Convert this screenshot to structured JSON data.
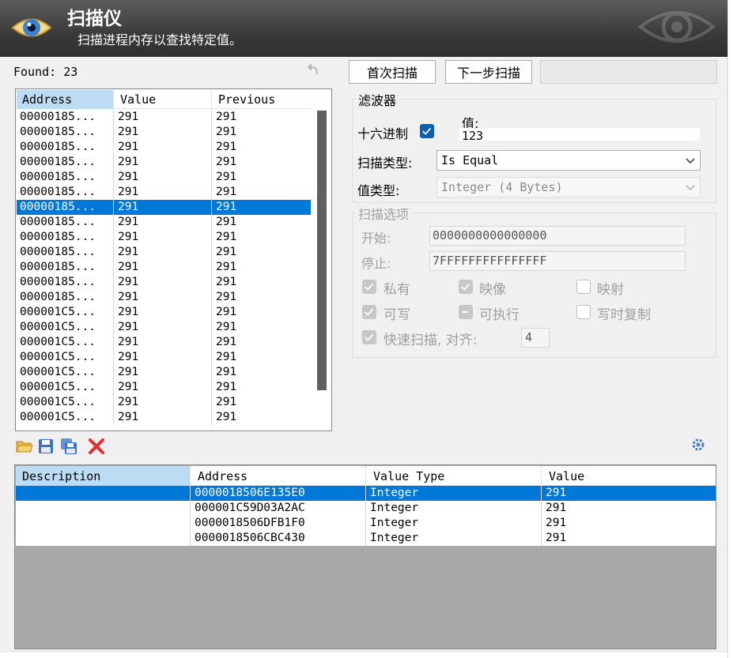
{
  "header": {
    "title": "扫描仪",
    "subtitle": "扫描进程内存以查找特定值。"
  },
  "found_label": "Found: 23",
  "buttons": {
    "first_scan": "首次扫描",
    "next_scan": "下一步扫描",
    "undo_scan": ""
  },
  "results": {
    "columns": [
      "Address",
      "Value",
      "Previous"
    ],
    "selected_index": 6,
    "rows": [
      [
        "00000185...",
        "291",
        "291"
      ],
      [
        "00000185...",
        "291",
        "291"
      ],
      [
        "00000185...",
        "291",
        "291"
      ],
      [
        "00000185...",
        "291",
        "291"
      ],
      [
        "00000185...",
        "291",
        "291"
      ],
      [
        "00000185...",
        "291",
        "291"
      ],
      [
        "00000185...",
        "291",
        "291"
      ],
      [
        "00000185...",
        "291",
        "291"
      ],
      [
        "00000185...",
        "291",
        "291"
      ],
      [
        "00000185...",
        "291",
        "291"
      ],
      [
        "00000185...",
        "291",
        "291"
      ],
      [
        "00000185...",
        "291",
        "291"
      ],
      [
        "00000185...",
        "291",
        "291"
      ],
      [
        "000001C5...",
        "291",
        "291"
      ],
      [
        "000001C5...",
        "291",
        "291"
      ],
      [
        "000001C5...",
        "291",
        "291"
      ],
      [
        "000001C5...",
        "291",
        "291"
      ],
      [
        "000001C5...",
        "291",
        "291"
      ],
      [
        "000001C5...",
        "291",
        "291"
      ],
      [
        "000001C5...",
        "291",
        "291"
      ],
      [
        "000001C5...",
        "291",
        "291"
      ]
    ]
  },
  "filter": {
    "group_label": "滤波器",
    "hex_label": "十六进制",
    "hex_checked": true,
    "value_label": "值:",
    "value": "123",
    "scan_type_label": "扫描类型:",
    "scan_type": "Is Equal",
    "value_type_label": "值类型:",
    "value_type": "Integer (4 Bytes)"
  },
  "scan_options": {
    "group_label": "扫描选项",
    "start_label": "开始:",
    "start_value": "0000000000000000",
    "stop_label": "停止:",
    "stop_value": "7FFFFFFFFFFFFFFF",
    "private": "私有",
    "image": "映像",
    "mapped": "映射",
    "writable": "可写",
    "executable": "可执行",
    "copy_on_write": "写时复制",
    "fast_scan": "快速扫描, 对齐:",
    "alignment": "4"
  },
  "toolbar_icons": [
    "open-folder-icon",
    "save-icon",
    "save-all-icon",
    "delete-icon"
  ],
  "addresses": {
    "columns": [
      "Description",
      "Address",
      "Value Type",
      "Value"
    ],
    "selected_index": 0,
    "rows": [
      [
        "",
        "0000018506E135E0",
        "Integer",
        "291"
      ],
      [
        "",
        "000001C59D03A2AC",
        "Integer",
        "291"
      ],
      [
        "",
        "0000018506DFB1F0",
        "Integer",
        "291"
      ],
      [
        "",
        "0000018506CBC430",
        "Integer",
        "291"
      ]
    ]
  },
  "colors": {
    "selection": "#0078d7",
    "header_column_selected": "#bcdcf4",
    "checkbox_checked": "#0b5fb3"
  }
}
